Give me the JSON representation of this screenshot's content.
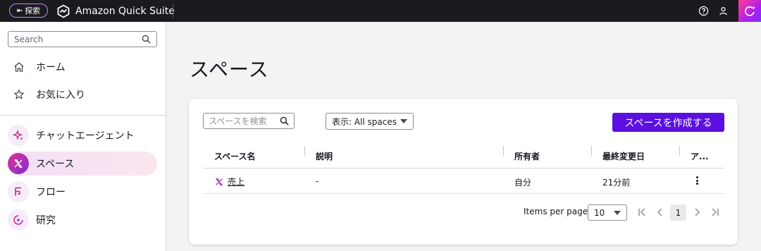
{
  "topbar": {
    "explore_label": "探索",
    "app_title": "Amazon Quick Suite",
    "icons": [
      "collapse-icon",
      "quick-suite-logo-icon",
      "help-icon",
      "user-icon",
      "ai-assistant-icon"
    ]
  },
  "sidebar": {
    "search_placeholder": "Search",
    "items": [
      {
        "label": "ホーム",
        "icon": "home-icon"
      },
      {
        "label": "お気に入り",
        "icon": "star-icon"
      },
      {
        "label": "チャットエージェント",
        "icon": "sparkle-icon"
      },
      {
        "label": "スペース",
        "icon": "spaces-icon",
        "active": true
      },
      {
        "label": "フロー",
        "icon": "flow-icon"
      },
      {
        "label": "研究",
        "icon": "research-icon"
      }
    ]
  },
  "main": {
    "title": "スペース",
    "search_placeholder": "スペースを検索",
    "filter_label": "表示: All spaces",
    "create_button": "スペースを作成する",
    "columns": [
      "スペース名",
      "説明",
      "所有者",
      "最終変更日",
      "ア..."
    ],
    "rows": [
      {
        "name": "売上",
        "description": "-",
        "owner": "自分",
        "modified": "21分前"
      }
    ],
    "pagination": {
      "items_per_page_label": "Items per page",
      "items_per_page": "10",
      "current_page": "1"
    }
  },
  "colors": {
    "accent": "#5b10e0",
    "topbar": "#1b1b1f",
    "brand_gradient_start": "#e1338f",
    "brand_gradient_end": "#7a2fd6"
  }
}
